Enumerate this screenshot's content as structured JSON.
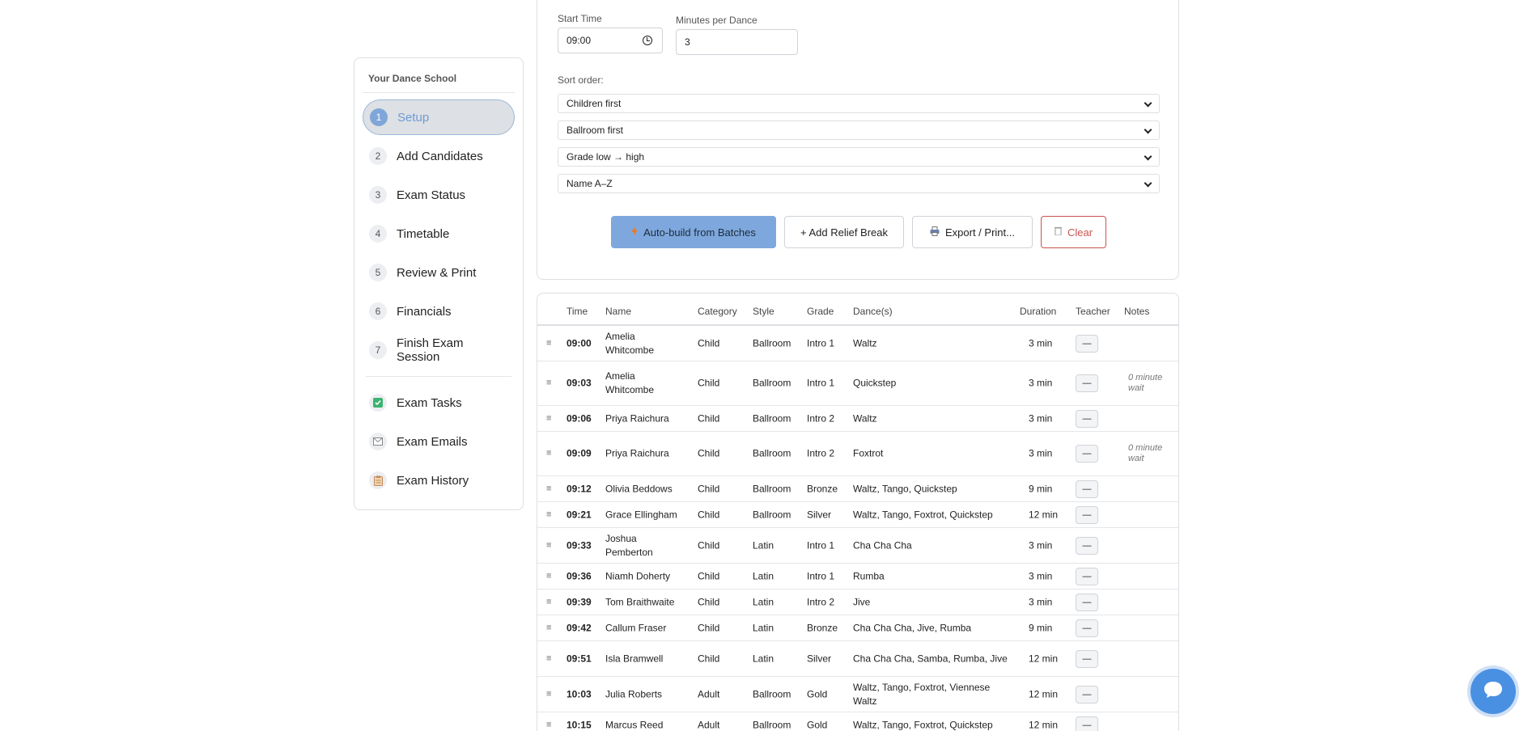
{
  "sidebar": {
    "school_name": "Your Dance School",
    "steps": [
      {
        "num": "1",
        "label": "Setup"
      },
      {
        "num": "2",
        "label": "Add Candidates"
      },
      {
        "num": "3",
        "label": "Exam Status"
      },
      {
        "num": "4",
        "label": "Timetable"
      },
      {
        "num": "5",
        "label": "Review & Print"
      },
      {
        "num": "6",
        "label": "Financials"
      },
      {
        "num": "7",
        "label": "Finish Exam Session"
      }
    ],
    "extras": [
      {
        "label": "Exam Tasks",
        "icon": "checkbox-icon"
      },
      {
        "label": "Exam Emails",
        "icon": "envelope-icon"
      },
      {
        "label": "Exam History",
        "icon": "clipboard-icon"
      }
    ]
  },
  "settings": {
    "start_time_label": "Start Time",
    "start_time_value": "09:00",
    "minutes_label": "Minutes per Dance",
    "minutes_value": "3",
    "sort_label": "Sort order:",
    "sorts": [
      "Children first",
      "Ballroom first",
      "Grade low → high",
      "Name A–Z"
    ],
    "buttons": {
      "auto": "Auto-build from Batches",
      "relief": "+ Add Relief Break",
      "export": "Export / Print...",
      "clear": "Clear"
    }
  },
  "table": {
    "headers": {
      "time": "Time",
      "name": "Name",
      "category": "Category",
      "style": "Style",
      "grade": "Grade",
      "dances": "Dance(s)",
      "duration": "Duration",
      "teacher": "Teacher",
      "notes": "Notes"
    },
    "teacher_btn": "—",
    "rows": [
      {
        "time": "09:00",
        "name": "Amelia Whitcombe",
        "category": "Child",
        "style": "Ballroom",
        "grade": "Intro 1",
        "dances": "Waltz",
        "duration": "3 min",
        "notes": ""
      },
      {
        "time": "09:03",
        "name": "Amelia Whitcombe",
        "category": "Child",
        "style": "Ballroom",
        "grade": "Intro 1",
        "dances": "Quickstep",
        "duration": "3 min",
        "notes": "0 minute wait"
      },
      {
        "time": "09:06",
        "name": "Priya Raichura",
        "category": "Child",
        "style": "Ballroom",
        "grade": "Intro 2",
        "dances": "Waltz",
        "duration": "3 min",
        "notes": ""
      },
      {
        "time": "09:09",
        "name": "Priya Raichura",
        "category": "Child",
        "style": "Ballroom",
        "grade": "Intro 2",
        "dances": "Foxtrot",
        "duration": "3 min",
        "notes": "0 minute wait"
      },
      {
        "time": "09:12",
        "name": "Olivia Beddows",
        "category": "Child",
        "style": "Ballroom",
        "grade": "Bronze",
        "dances": "Waltz, Tango, Quickstep",
        "duration": "9 min",
        "notes": ""
      },
      {
        "time": "09:21",
        "name": "Grace Ellingham",
        "category": "Child",
        "style": "Ballroom",
        "grade": "Silver",
        "dances": "Waltz, Tango, Foxtrot, Quickstep",
        "duration": "12 min",
        "notes": ""
      },
      {
        "time": "09:33",
        "name": "Joshua Pemberton",
        "category": "Child",
        "style": "Latin",
        "grade": "Intro 1",
        "dances": "Cha Cha Cha",
        "duration": "3 min",
        "notes": ""
      },
      {
        "time": "09:36",
        "name": "Niamh Doherty",
        "category": "Child",
        "style": "Latin",
        "grade": "Intro 1",
        "dances": "Rumba",
        "duration": "3 min",
        "notes": ""
      },
      {
        "time": "09:39",
        "name": "Tom Braithwaite",
        "category": "Child",
        "style": "Latin",
        "grade": "Intro 2",
        "dances": "Jive",
        "duration": "3 min",
        "notes": ""
      },
      {
        "time": "09:42",
        "name": "Callum Fraser",
        "category": "Child",
        "style": "Latin",
        "grade": "Bronze",
        "dances": "Cha Cha Cha, Jive, Rumba",
        "duration": "9 min",
        "notes": ""
      },
      {
        "time": "09:51",
        "name": "Isla Bramwell",
        "category": "Child",
        "style": "Latin",
        "grade": "Silver",
        "dances": "Cha Cha Cha, Samba, Rumba, Jive",
        "duration": "12 min",
        "notes": ""
      },
      {
        "time": "10:03",
        "name": "Julia Roberts",
        "category": "Adult",
        "style": "Ballroom",
        "grade": "Gold",
        "dances": "Waltz, Tango, Foxtrot, Viennese Waltz",
        "duration": "12 min",
        "notes": ""
      },
      {
        "time": "10:15",
        "name": "Marcus Reed",
        "category": "Adult",
        "style": "Ballroom",
        "grade": "Gold",
        "dances": "Waltz, Tango, Foxtrot, Quickstep",
        "duration": "12 min",
        "notes": ""
      }
    ]
  }
}
